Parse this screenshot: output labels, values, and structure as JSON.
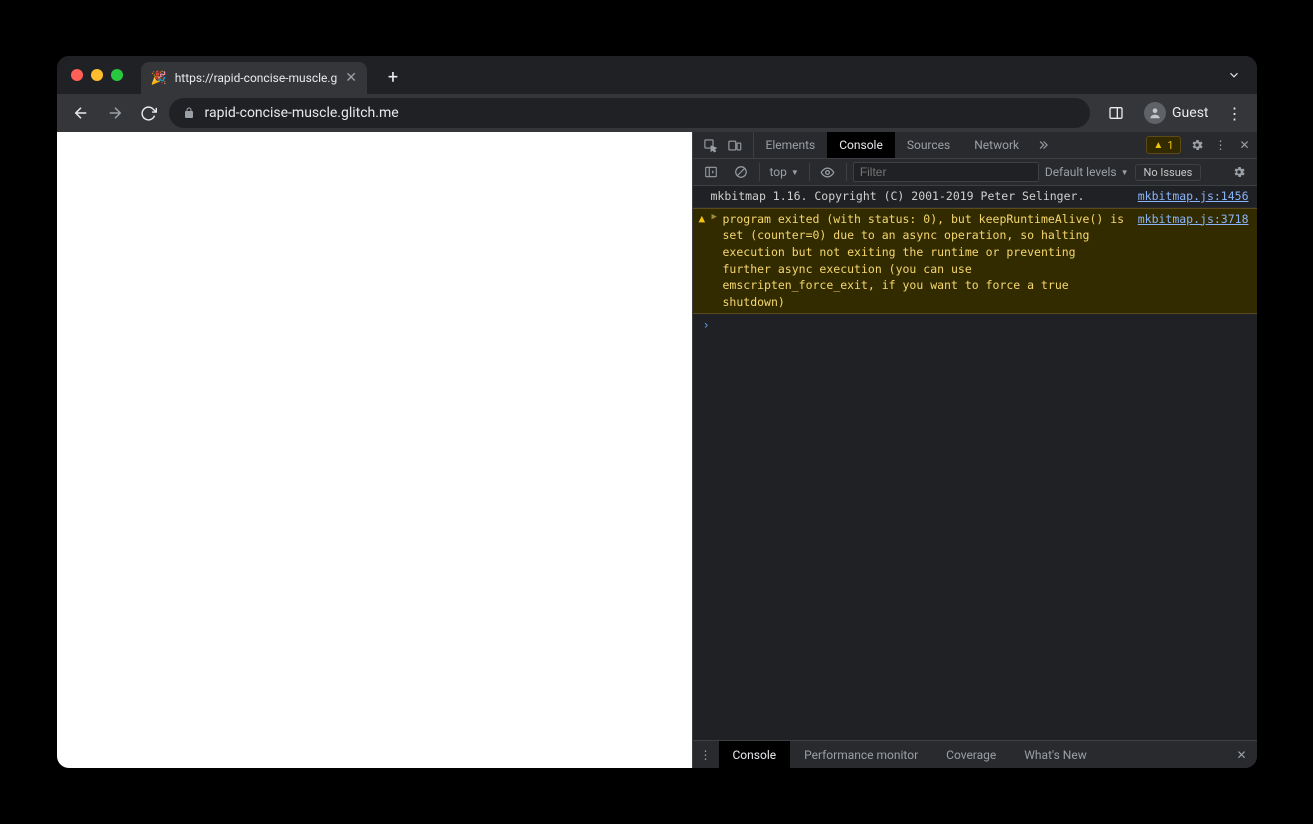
{
  "tab": {
    "title": "https://rapid-concise-muscle.g",
    "favicon": "🎉"
  },
  "omnibox": {
    "url": "rapid-concise-muscle.glitch.me"
  },
  "toolbar": {
    "guest_label": "Guest"
  },
  "devtools": {
    "tabs": {
      "elements": "Elements",
      "console": "Console",
      "sources": "Sources",
      "network": "Network"
    },
    "warn_count": "1",
    "consolebar": {
      "context": "top",
      "filter_placeholder": "Filter",
      "levels_label": "Default levels",
      "issues_label": "No Issues"
    },
    "logs": {
      "info_msg": "mkbitmap 1.16. Copyright (C) 2001-2019 Peter Selinger.",
      "info_src": "mkbitmap.js:1456",
      "warn_msg": "program exited (with status: 0), but keepRuntimeAlive() is set (counter=0) due to an async operation, so halting execution but not exiting the runtime or preventing further async execution (you can use emscripten_force_exit, if you want to force a true shutdown)",
      "warn_src": "mkbitmap.js:3718"
    },
    "drawer": {
      "console": "Console",
      "perf": "Performance monitor",
      "coverage": "Coverage",
      "whatsnew": "What's New"
    }
  }
}
